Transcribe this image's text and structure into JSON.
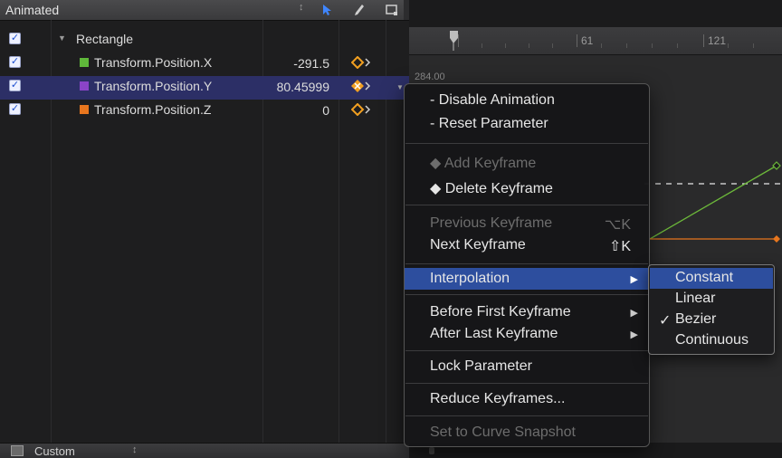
{
  "parameter_list": {
    "title": "Animated",
    "sort_glyph": "↕",
    "tools": [
      {
        "name": "arrow-tool-icon",
        "active": true
      },
      {
        "name": "pen-tool-icon",
        "active": false
      },
      {
        "name": "frame-tool-icon",
        "active": false
      }
    ],
    "group": {
      "label": "Rectangle",
      "enabled": true
    },
    "parameters": [
      {
        "label": "Transform.Position.X",
        "value": "-291.5",
        "color": "#5fb83a",
        "enabled": true,
        "selected": false
      },
      {
        "label": "Transform.Position.Y",
        "value": "80.45999",
        "color": "#8a44c8",
        "enabled": true,
        "selected": true
      },
      {
        "label": "Transform.Position.Z",
        "value": "0",
        "color": "#e8761e",
        "enabled": true,
        "selected": false
      }
    ],
    "footer": {
      "label": "Custom",
      "sort_glyph": "↕"
    }
  },
  "graph": {
    "ruler_labels": [
      "61",
      "121"
    ],
    "value_label": "284.00",
    "curve_colors": {
      "x": "#6cb83a",
      "z": "#e8761e"
    }
  },
  "context_menu": {
    "items": [
      {
        "label": "- Disable Animation",
        "enabled": true
      },
      {
        "label": "- Reset Parameter",
        "enabled": true
      },
      {
        "separator": true
      },
      {
        "label": "◆ Add Keyframe",
        "enabled": false
      },
      {
        "label": "◆ Delete Keyframe",
        "enabled": true
      },
      {
        "separator": true
      },
      {
        "label": "Previous Keyframe",
        "shortcut": "⌥K",
        "enabled": false
      },
      {
        "label": "Next Keyframe",
        "shortcut": "⇧K",
        "enabled": true
      },
      {
        "separator": true
      },
      {
        "label": "Interpolation",
        "submenu": true,
        "enabled": true,
        "highlighted": true
      },
      {
        "separator": true
      },
      {
        "label": "Before First Keyframe",
        "submenu": true,
        "enabled": true
      },
      {
        "label": "After Last Keyframe",
        "submenu": true,
        "enabled": true
      },
      {
        "separator": true
      },
      {
        "label": "Lock Parameter",
        "enabled": true
      },
      {
        "separator": true
      },
      {
        "label": "Reduce Keyframes...",
        "enabled": true
      },
      {
        "separator": true
      },
      {
        "label": "Set to Curve Snapshot",
        "enabled": false
      }
    ]
  },
  "interpolation_submenu": {
    "items": [
      {
        "label": "Constant",
        "highlighted": true,
        "checked": false
      },
      {
        "label": "Linear",
        "highlighted": false,
        "checked": false
      },
      {
        "label": "Bezier",
        "highlighted": false,
        "checked": true
      },
      {
        "label": "Continuous",
        "highlighted": false,
        "checked": false
      }
    ],
    "checkmark": "✓"
  }
}
